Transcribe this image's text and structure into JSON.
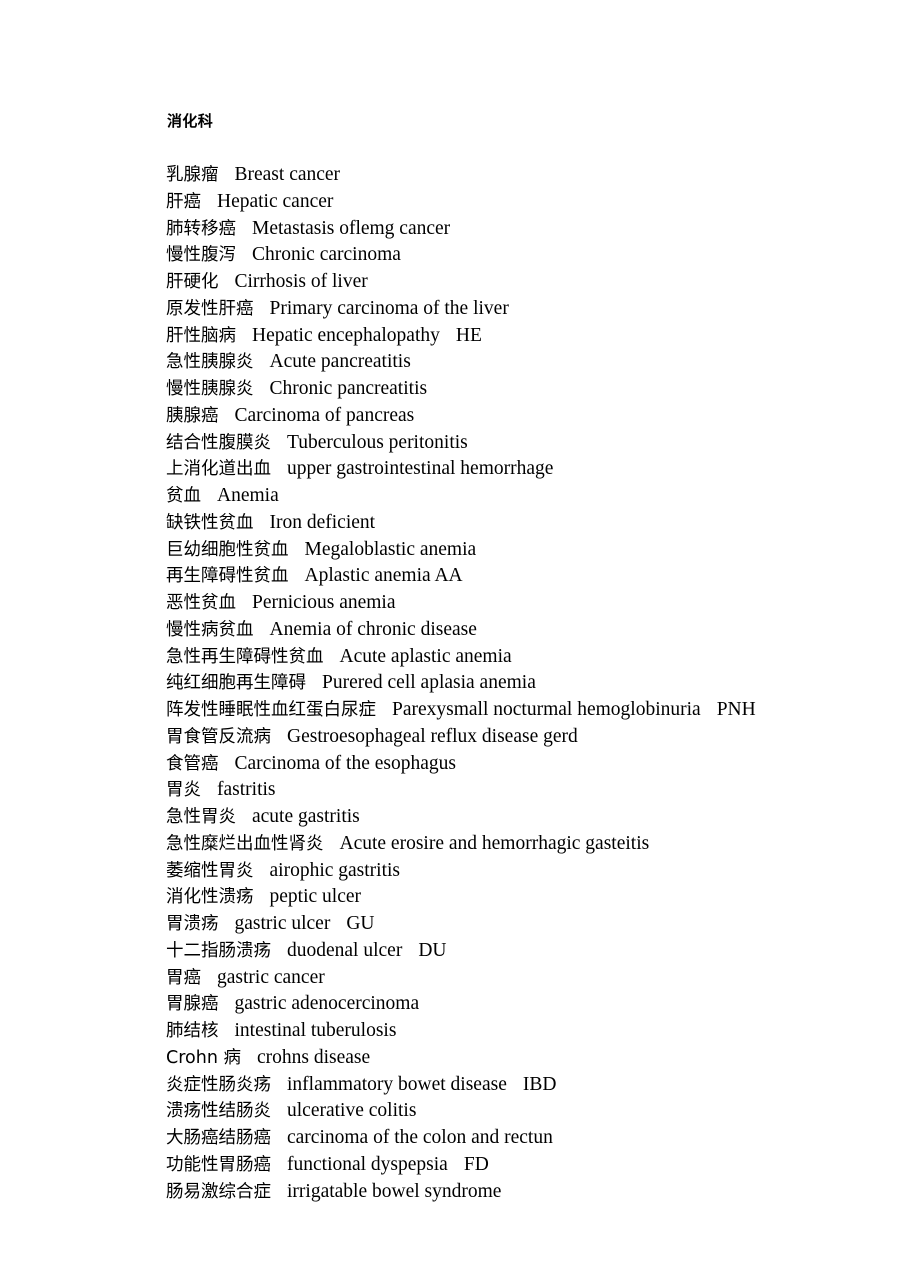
{
  "document": {
    "title": "消化科",
    "entries": [
      {
        "cn": "乳腺瘤",
        "en": "Breast cancer",
        "abbr": ""
      },
      {
        "cn": "肝癌",
        "en": "Hepatic cancer",
        "abbr": ""
      },
      {
        "cn": "肺转移癌",
        "en": "Metastasis oflemg cancer",
        "abbr": ""
      },
      {
        "cn": "慢性腹泻",
        "en": "Chronic carcinoma",
        "abbr": ""
      },
      {
        "cn": "肝硬化",
        "en": "Cirrhosis of liver",
        "abbr": ""
      },
      {
        "cn": "原发性肝癌",
        "en": "Primary carcinoma of the liver",
        "abbr": ""
      },
      {
        "cn": "肝性脑病",
        "en": "Hepatic encephalopathy",
        "abbr": "HE"
      },
      {
        "cn": "急性胰腺炎",
        "en": "Acute pancreatitis",
        "abbr": ""
      },
      {
        "cn": "慢性胰腺炎",
        "en": "Chronic pancreatitis",
        "abbr": ""
      },
      {
        "cn": "胰腺癌",
        "en": "Carcinoma of pancreas",
        "abbr": ""
      },
      {
        "cn": "结合性腹膜炎",
        "en": "Tuberculous peritonitis",
        "abbr": ""
      },
      {
        "cn": "上消化道出血",
        "en": "upper gastrointestinal hemorrhage",
        "abbr": ""
      },
      {
        "cn": "贫血",
        "en": "Anemia",
        "abbr": ""
      },
      {
        "cn": "缺铁性贫血",
        "en": "Iron deficient",
        "abbr": ""
      },
      {
        "cn": "巨幼细胞性贫血",
        "en": "Megaloblastic anemia",
        "abbr": ""
      },
      {
        "cn": "再生障碍性贫血",
        "en": "Aplastic anemia AA",
        "abbr": ""
      },
      {
        "cn": "恶性贫血",
        "en": "Pernicious anemia",
        "abbr": ""
      },
      {
        "cn": "慢性病贫血",
        "en": "Anemia of chronic disease",
        "abbr": ""
      },
      {
        "cn": "急性再生障碍性贫血",
        "en": "Acute aplastic anemia",
        "abbr": ""
      },
      {
        "cn": "纯红细胞再生障碍",
        "en": "Purered cell aplasia anemia",
        "abbr": ""
      },
      {
        "cn": "阵发性睡眠性血红蛋白尿症",
        "en": "Parexysmall nocturmal hemoglobinuria",
        "abbr": "PNH"
      },
      {
        "cn": "胃食管反流病",
        "en": "Gestroesophageal reflux disease gerd",
        "abbr": ""
      },
      {
        "cn": "食管癌",
        "en": "Carcinoma of the esophagus",
        "abbr": ""
      },
      {
        "cn": "胃炎",
        "en": "fastritis",
        "abbr": ""
      },
      {
        "cn": "急性胃炎",
        "en": "acute gastritis",
        "abbr": ""
      },
      {
        "cn": "急性糜烂出血性肾炎",
        "en": "Acute erosire and hemorrhagic gasteitis",
        "abbr": ""
      },
      {
        "cn": "萎缩性胃炎",
        "en": "airophic gastritis",
        "abbr": ""
      },
      {
        "cn": "消化性溃疡",
        "en": "peptic ulcer",
        "abbr": ""
      },
      {
        "cn": "胃溃疡",
        "en": "gastric ulcer",
        "abbr": "GU"
      },
      {
        "cn": "十二指肠溃疡",
        "en": "duodenal ulcer",
        "abbr": "DU"
      },
      {
        "cn": "胃癌",
        "en": "gastric cancer",
        "abbr": ""
      },
      {
        "cn": "胃腺癌",
        "en": "gastric adenocercinoma",
        "abbr": ""
      },
      {
        "cn": "肺结核",
        "en": "intestinal tuberulosis",
        "abbr": ""
      },
      {
        "cn": "Crohn 病",
        "en": "crohns disease",
        "abbr": ""
      },
      {
        "cn": "炎症性肠炎疡",
        "en": "inflammatory bowet disease",
        "abbr": "IBD"
      },
      {
        "cn": "溃疡性结肠炎",
        "en": "ulcerative colitis",
        "abbr": ""
      },
      {
        "cn": "大肠癌结肠癌",
        "en": "carcinoma of the colon and rectun",
        "abbr": ""
      },
      {
        "cn": "功能性胃肠癌",
        "en": "functional dyspepsia",
        "abbr": "FD"
      },
      {
        "cn": "肠易激综合症",
        "en": "irrigatable bowel syndrome",
        "abbr": ""
      }
    ]
  },
  "colors": {
    "page_background": "#ffffff",
    "text": "#000000"
  }
}
